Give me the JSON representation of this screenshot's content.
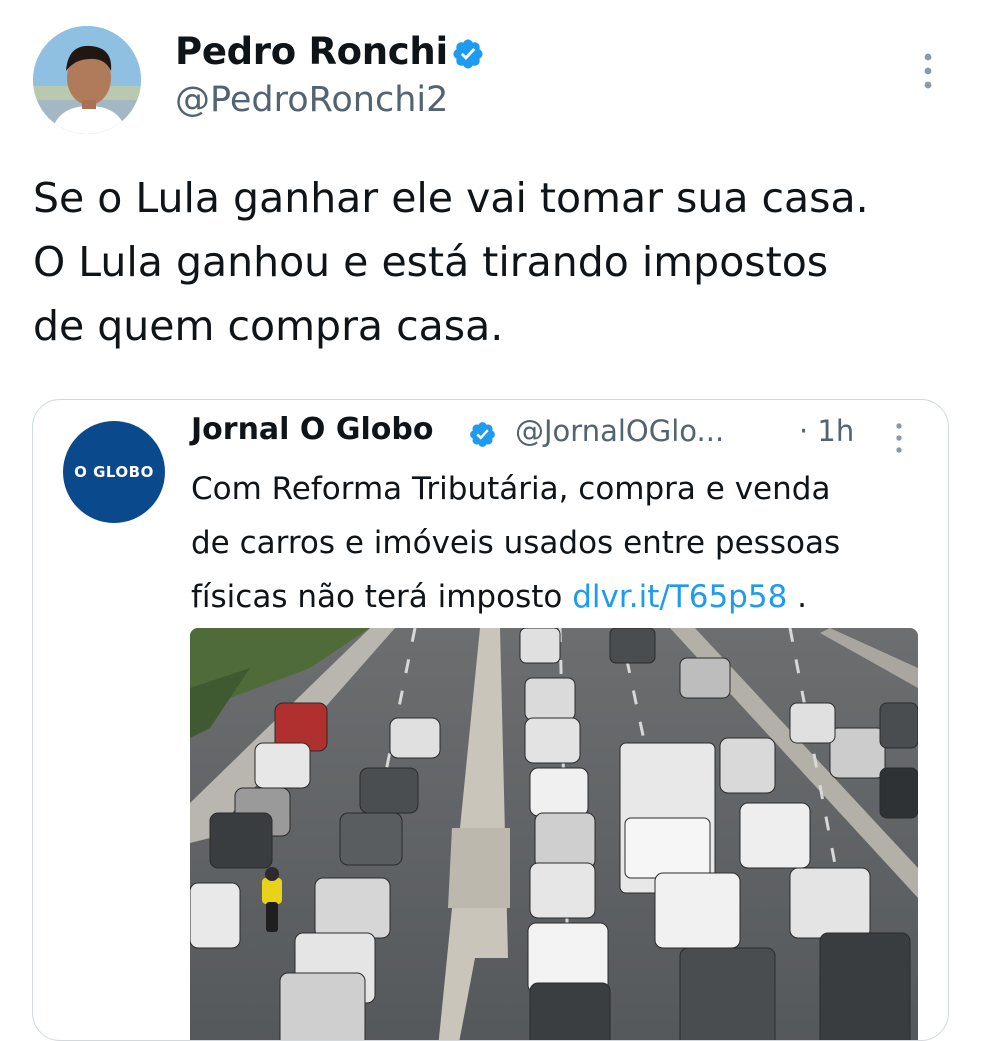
{
  "author": {
    "name": "Pedro Ronchi",
    "handle": "@PedroRonchi2",
    "verified": true
  },
  "tweet": {
    "lines": [
      "Se o Lula ganhar ele vai tomar sua casa.",
      "O Lula ganhou e está tirando impostos",
      "de quem compra casa."
    ]
  },
  "quoted": {
    "avatar_text": "O GLOBO",
    "name": "Jornal O Globo",
    "handle": "@JornalOGlo...",
    "time": "· 1h",
    "verified": true,
    "text_lines": [
      "Com Reforma Tributária, compra e venda",
      "de carros e imóveis usados entre pessoas"
    ],
    "text_last_prefix": "físicas não terá imposto ",
    "link": "dlvr.it/T65p58",
    "text_last_suffix": " ."
  },
  "icons": {
    "verified": "verified-badge-icon",
    "more": "more-vertical-icon"
  },
  "colors": {
    "verified_blue": "#1d9bf0",
    "link_blue": "#1d9bf0",
    "secondary_text": "#536471",
    "globo_blue": "#0a4a8c"
  }
}
